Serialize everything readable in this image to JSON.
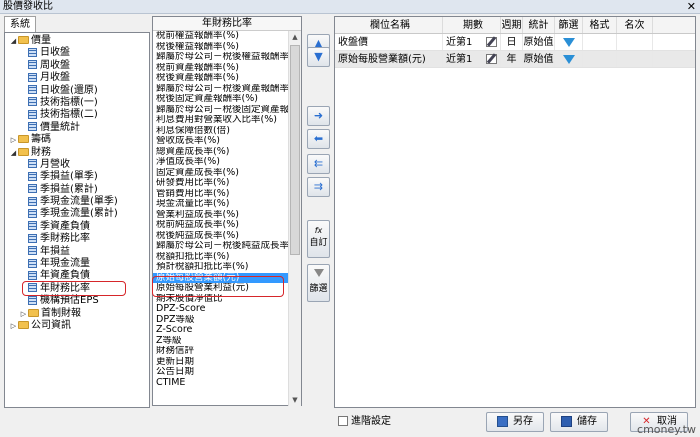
{
  "window": {
    "title": "股價發收比",
    "close": "✕"
  },
  "tabs": [
    {
      "label": "系統"
    }
  ],
  "tree": [
    {
      "level": 0,
      "label": "價量",
      "expanded": true,
      "type": "folder"
    },
    {
      "level": 1,
      "label": "日收盤",
      "type": "item"
    },
    {
      "level": 1,
      "label": "周收盤",
      "type": "item"
    },
    {
      "level": 1,
      "label": "月收盤",
      "type": "item"
    },
    {
      "level": 1,
      "label": "日收盤(還原)",
      "type": "item"
    },
    {
      "level": 1,
      "label": "技術指標(一)",
      "type": "item"
    },
    {
      "level": 1,
      "label": "技術指標(二)",
      "type": "item"
    },
    {
      "level": 1,
      "label": "價量統計",
      "type": "item"
    },
    {
      "level": 0,
      "label": "籌碼",
      "expanded": false,
      "type": "folder"
    },
    {
      "level": 0,
      "label": "財務",
      "expanded": true,
      "type": "folder"
    },
    {
      "level": 1,
      "label": "月營收",
      "type": "item"
    },
    {
      "level": 1,
      "label": "季損益(單季)",
      "type": "item"
    },
    {
      "level": 1,
      "label": "季損益(累計)",
      "type": "item"
    },
    {
      "level": 1,
      "label": "季現金流量(單季)",
      "type": "item"
    },
    {
      "level": 1,
      "label": "季現金流量(累計)",
      "type": "item"
    },
    {
      "level": 1,
      "label": "季資產負債",
      "type": "item"
    },
    {
      "level": 1,
      "label": "季財務比率",
      "type": "item"
    },
    {
      "level": 1,
      "label": "年損益",
      "type": "item"
    },
    {
      "level": 1,
      "label": "年現金流量",
      "type": "item"
    },
    {
      "level": 1,
      "label": "年資產負債",
      "type": "item"
    },
    {
      "level": 1,
      "label": "年財務比率",
      "type": "item",
      "highlight": true
    },
    {
      "level": 1,
      "label": "機構預估EPS",
      "type": "item"
    },
    {
      "level": 1,
      "label": "首制財報",
      "expanded": false,
      "type": "folder"
    },
    {
      "level": 0,
      "label": "公司資訊",
      "expanded": false,
      "type": "folder"
    }
  ],
  "list": {
    "header": "年財務比率",
    "items": [
      "稅前權益報酬率(%)",
      "稅後權益報酬率(%)",
      "歸屬於母公司－稅後權益報酬率(",
      "稅前資產報酬率(%)",
      "稅後資產報酬率(%)",
      "歸屬於母公司－稅後資產報酬率(",
      "稅後固定資產報酬率(%)",
      "歸屬於母公司－稅後固定資產報",
      "利息費用對營業收入比率(%)",
      "利息保障倍數(倍)",
      "營收成長率(%)",
      "總資產成長率(%)",
      "淨值成長率(%)",
      "固定資產成長率(%)",
      "研發費用比率(%)",
      "管銷費用比率(%)",
      "現金流量比率(%)",
      "營業利益成長率(%)",
      "稅前純益成長率(%)",
      "稅後純益成長率(%)",
      "歸屬於母公司－稅後純益成長率(",
      "稅額扣抵比率(%)",
      "預計稅額扣抵比率(%)",
      "原始每股營業額(元)",
      "原始每股營業利益(元)",
      "期末股價淨值比",
      "DPZ-Score",
      "DPZ等級",
      "Z-Score",
      "Z等級",
      "財務信評",
      "更新日期",
      "公告日期",
      "CTIME"
    ],
    "selected_index": 23
  },
  "side_buttons": {
    "up": "▲",
    "down": "▼",
    "add": "➜",
    "remove": "⬅",
    "add_all": "⇉",
    "remove_all": "⇇",
    "custom_label": "自訂",
    "custom_icon": "fx",
    "filter_label": "篩選"
  },
  "table": {
    "columns": [
      "欄位名稱",
      "期數",
      "週期",
      "統計",
      "篩選",
      "格式",
      "名次"
    ],
    "rows": [
      {
        "name": "收盤價",
        "period": "近第1",
        "cycle": "日",
        "stat": "原始值",
        "format": "",
        "rank": ""
      },
      {
        "name": "原始每股營業額(元)",
        "period": "近第1",
        "cycle": "年",
        "stat": "原始值",
        "format": "",
        "rank": ""
      }
    ]
  },
  "bottom": {
    "advanced_label": "進階設定",
    "save_as_label": "另存",
    "save_label": "儲存",
    "cancel_label": "取消"
  },
  "watermark": "cmoney.tw"
}
